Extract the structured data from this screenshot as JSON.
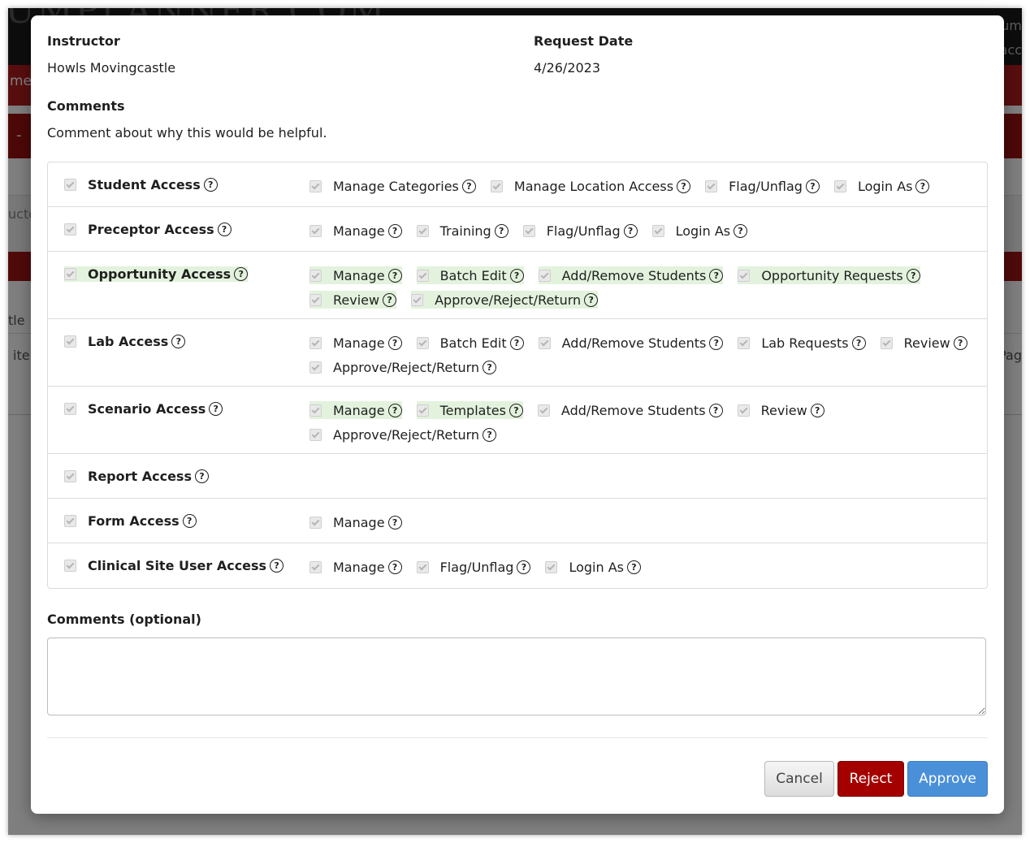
{
  "background": {
    "logo_text": "UMPLANNER.COM",
    "nav_text": "me",
    "dash": "-",
    "gray_text": "ucto",
    "th_text": "tle",
    "row_text": "iter",
    "row_right": "Pag",
    "top_right_1": "um",
    "top_right_2": "acc"
  },
  "info": {
    "instructor_label": "Instructor",
    "instructor_value": "Howls Movingcastle",
    "request_date_label": "Request Date",
    "request_date_value": "4/26/2023",
    "comments_label": "Comments",
    "comments_value": "Comment about why this would be helpful."
  },
  "permissions": [
    {
      "label": "Student Access",
      "highlight": false,
      "options": [
        {
          "label": "Manage Categories",
          "highlight": false
        },
        {
          "label": "Manage Location Access",
          "highlight": false
        },
        {
          "label": "Flag/Unflag",
          "highlight": false
        },
        {
          "label": "Login As",
          "highlight": false
        }
      ]
    },
    {
      "label": "Preceptor Access",
      "highlight": false,
      "options": [
        {
          "label": "Manage",
          "highlight": false
        },
        {
          "label": "Training",
          "highlight": false
        },
        {
          "label": "Flag/Unflag",
          "highlight": false
        },
        {
          "label": "Login As",
          "highlight": false
        }
      ]
    },
    {
      "label": "Opportunity Access",
      "highlight": true,
      "options": [
        {
          "label": "Manage",
          "highlight": true
        },
        {
          "label": "Batch Edit",
          "highlight": true
        },
        {
          "label": "Add/Remove Students",
          "highlight": true
        },
        {
          "label": "Opportunity Requests",
          "highlight": true
        },
        {
          "label": "Review",
          "highlight": true
        },
        {
          "label": "Approve/Reject/Return",
          "highlight": true
        }
      ]
    },
    {
      "label": "Lab Access",
      "highlight": false,
      "options": [
        {
          "label": "Manage",
          "highlight": false
        },
        {
          "label": "Batch Edit",
          "highlight": false
        },
        {
          "label": "Add/Remove Students",
          "highlight": false
        },
        {
          "label": "Lab Requests",
          "highlight": false
        },
        {
          "label": "Review",
          "highlight": false
        },
        {
          "label": "Approve/Reject/Return",
          "highlight": false
        }
      ]
    },
    {
      "label": "Scenario Access",
      "highlight": false,
      "options": [
        {
          "label": "Manage",
          "highlight": true
        },
        {
          "label": "Templates",
          "highlight": true
        },
        {
          "label": "Add/Remove Students",
          "highlight": false
        },
        {
          "label": "Review",
          "highlight": false
        },
        {
          "label": "Approve/Reject/Return",
          "highlight": false
        }
      ]
    },
    {
      "label": "Report Access",
      "highlight": false,
      "options": []
    },
    {
      "label": "Form Access",
      "highlight": false,
      "options": [
        {
          "label": "Manage",
          "highlight": false
        }
      ]
    },
    {
      "label": "Clinical Site User Access",
      "highlight": false,
      "options": [
        {
          "label": "Manage",
          "highlight": false
        },
        {
          "label": "Flag/Unflag",
          "highlight": false
        },
        {
          "label": "Login As",
          "highlight": false
        }
      ]
    }
  ],
  "help_glyph": "?",
  "comments_optional_label": "Comments (optional)",
  "comments_optional_value": "",
  "buttons": {
    "cancel": "Cancel",
    "reject": "Reject",
    "approve": "Approve"
  },
  "colors": {
    "highlight": "#e3f2dd",
    "reject": "#a40000",
    "approve": "#4a90d9"
  }
}
